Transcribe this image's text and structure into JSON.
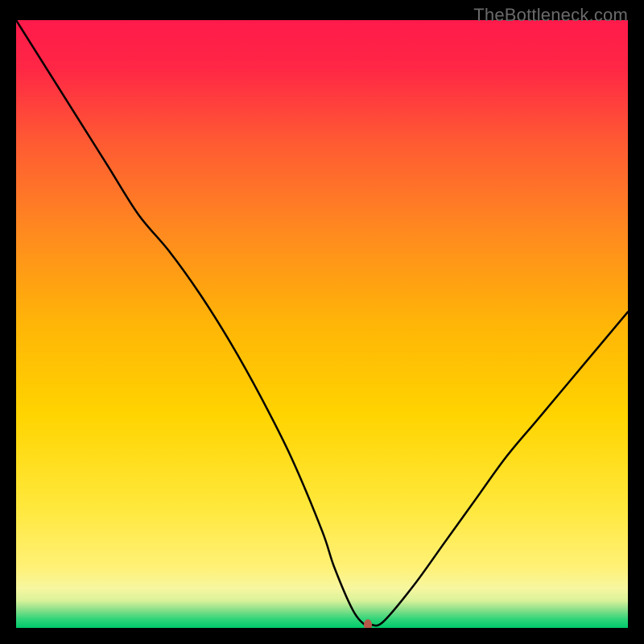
{
  "watermark": "TheBottleneck.com",
  "chart_data": {
    "type": "line",
    "title": "",
    "xlabel": "",
    "ylabel": "",
    "xlim": [
      0,
      100
    ],
    "ylim": [
      0,
      100
    ],
    "grid": false,
    "legend": false,
    "background_gradient": {
      "top_color": "#ff1744",
      "mid_colors": [
        "#ff5722",
        "#ffb300",
        "#ffeb3b",
        "#fff176"
      ],
      "bottom_color": "#00e676"
    },
    "series": [
      {
        "name": "curve",
        "color": "#000000",
        "x": [
          0,
          5,
          10,
          15,
          20,
          25,
          30,
          35,
          40,
          45,
          50,
          52,
          55,
          57,
          58,
          60,
          65,
          70,
          75,
          80,
          85,
          90,
          95,
          100
        ],
        "values": [
          100,
          92,
          84,
          76,
          68,
          62,
          55,
          47,
          38,
          28,
          16,
          10,
          3,
          0.5,
          0.5,
          1,
          7,
          14,
          21,
          28,
          34,
          40,
          46,
          52
        ]
      }
    ],
    "marker": {
      "x": 57.5,
      "y": 0.5,
      "color": "#b55a4a",
      "rx": 5,
      "ry": 7
    }
  }
}
